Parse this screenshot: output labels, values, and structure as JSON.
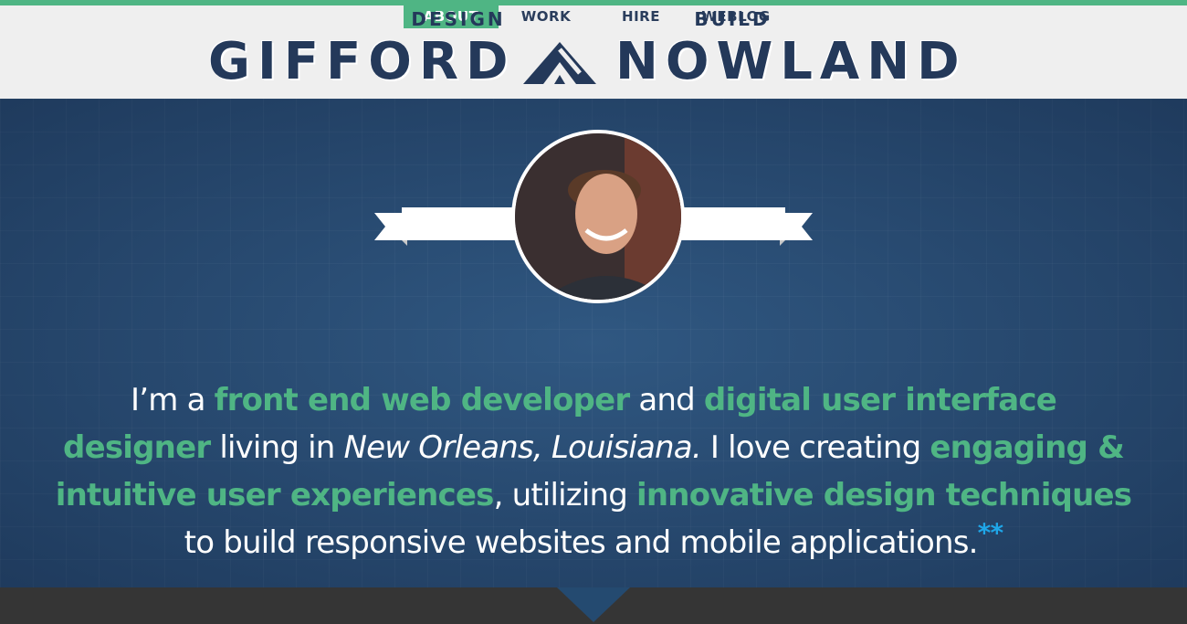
{
  "nav": {
    "items": [
      {
        "label": "ABOUT",
        "active": true
      },
      {
        "label": "WORK",
        "active": false
      },
      {
        "label": "HIRE",
        "active": false
      },
      {
        "label": "WEBLOG",
        "active": false
      }
    ]
  },
  "logo": {
    "left": "GIFFORD",
    "right": "NOWLAND",
    "mark_icon": "mountain-triangle-icon"
  },
  "hero": {
    "banner_left": "DESIGN",
    "banner_right": "BUILD",
    "avatar_icon": "profile-photo",
    "bio": {
      "t1": "I’m a ",
      "h1": "front end web developer",
      "t2": " and ",
      "h2": "digital user interface designer",
      "t3": " living in ",
      "i1": "New Orleans, Louisiana.",
      "t4": " I love creating ",
      "h3": "engaging & intuitive user experiences",
      "t5": ", utilizing ",
      "h4": "innovative design techniques",
      "t6": " to build responsive websites and mobile applications.",
      "asterisks": "**"
    }
  },
  "colors": {
    "accent_green": "#4fb584",
    "navy": "#24395a",
    "hero_blue": "#2c5179",
    "asterisk_blue": "#1fa6e8",
    "footer": "#353535"
  }
}
